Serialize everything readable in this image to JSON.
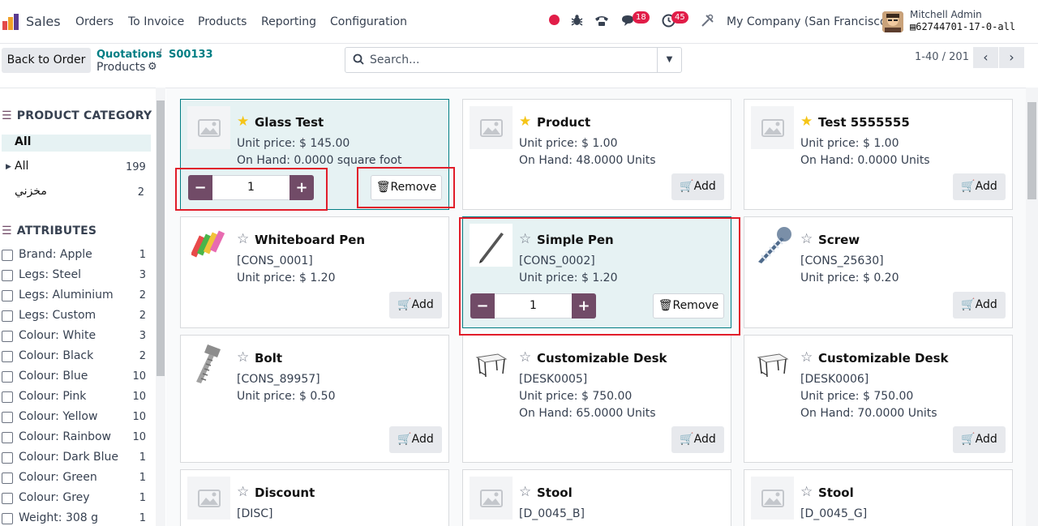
{
  "nav": {
    "app_name": "Sales",
    "menu": [
      "Orders",
      "To Invoice",
      "Products",
      "Reporting",
      "Configuration"
    ],
    "chat_badge": "18",
    "activity_badge": "45",
    "company": "My Company (San Francisco)",
    "user_name": "Mitchell Admin",
    "db_name": "62744701-17-0-all"
  },
  "control": {
    "back_label": "Back to Order",
    "breadcrumb": [
      "Quotations",
      "S00133"
    ],
    "title": "Products",
    "search_placeholder": "Search...",
    "pager": "1-40 / 201"
  },
  "sidebar": {
    "category_title": "PRODUCT CATEGORY",
    "categories": [
      {
        "label": "All",
        "count": "",
        "active": true
      },
      {
        "label": "All",
        "count": "199",
        "expandable": true
      },
      {
        "label": "مخزني",
        "count": "2"
      }
    ],
    "attributes_title": "ATTRIBUTES",
    "attributes": [
      {
        "label": "Brand: Apple",
        "count": "1"
      },
      {
        "label": "Legs: Steel",
        "count": "3"
      },
      {
        "label": "Legs: Aluminium",
        "count": "2"
      },
      {
        "label": "Legs: Custom",
        "count": "2"
      },
      {
        "label": "Colour: White",
        "count": "3"
      },
      {
        "label": "Colour: Black",
        "count": "2"
      },
      {
        "label": "Colour: Blue",
        "count": "10"
      },
      {
        "label": "Colour: Pink",
        "count": "10"
      },
      {
        "label": "Colour: Yellow",
        "count": "10"
      },
      {
        "label": "Colour: Rainbow",
        "count": "10"
      },
      {
        "label": "Colour: Dark Blue",
        "count": "1"
      },
      {
        "label": "Colour: Green",
        "count": "1"
      },
      {
        "label": "Colour: Grey",
        "count": "1"
      },
      {
        "label": "Weight: 308 g",
        "count": "1"
      }
    ]
  },
  "labels": {
    "add": "Add",
    "remove": "Remove"
  },
  "products": [
    {
      "name": "Glass Test",
      "favorite": true,
      "line1": "Unit price: $ 145.00",
      "line2": "On Hand: 0.0000 square foot",
      "in_order": true,
      "qty": "1",
      "image": "placeholder"
    },
    {
      "name": "Product",
      "favorite": true,
      "line1": "Unit price: $ 1.00",
      "line2": "On Hand: 48.0000 Units",
      "in_order": false,
      "image": "placeholder"
    },
    {
      "name": "Test 5555555",
      "favorite": true,
      "line1": "Unit price: $ 1.00",
      "line2": "On Hand: 0.0000 Units",
      "in_order": false,
      "image": "placeholder"
    },
    {
      "name": "Whiteboard Pen",
      "favorite": false,
      "line1": "[CONS_0001]",
      "line2": "Unit price: $ 1.20",
      "in_order": false,
      "image": "markers"
    },
    {
      "name": "Simple Pen",
      "favorite": false,
      "line1": "[CONS_0002]",
      "line2": "Unit price: $ 1.20",
      "in_order": true,
      "qty": "1",
      "image": "pen"
    },
    {
      "name": "Screw",
      "favorite": false,
      "line1": "[CONS_25630]",
      "line2": "Unit price: $ 0.20",
      "in_order": false,
      "image": "screw"
    },
    {
      "name": "Bolt",
      "favorite": false,
      "line1": "[CONS_89957]",
      "line2": "Unit price: $ 0.50",
      "in_order": false,
      "image": "bolt"
    },
    {
      "name": "Customizable Desk",
      "favorite": false,
      "line1": "[DESK0005]",
      "line2": "Unit price: $ 750.00",
      "line3": "On Hand: 65.0000 Units",
      "in_order": false,
      "image": "desk"
    },
    {
      "name": "Customizable Desk",
      "favorite": false,
      "line1": "[DESK0006]",
      "line2": "Unit price: $ 750.00",
      "line3": "On Hand: 70.0000 Units",
      "in_order": false,
      "image": "desk"
    },
    {
      "name": "Discount",
      "favorite": false,
      "line1": "[DISC]",
      "line2": "",
      "in_order": false,
      "image": "placeholder"
    },
    {
      "name": "Stool",
      "favorite": false,
      "line1": "[D_0045_B]",
      "line2": "",
      "in_order": false,
      "image": "placeholder"
    },
    {
      "name": "Stool",
      "favorite": false,
      "line1": "[D_0045_G]",
      "line2": "",
      "in_order": false,
      "image": "placeholder"
    }
  ],
  "colors": {
    "primary": "#714b67",
    "link": "#017e84",
    "badge": "#e11d48",
    "highlight": "#e11d2a"
  }
}
